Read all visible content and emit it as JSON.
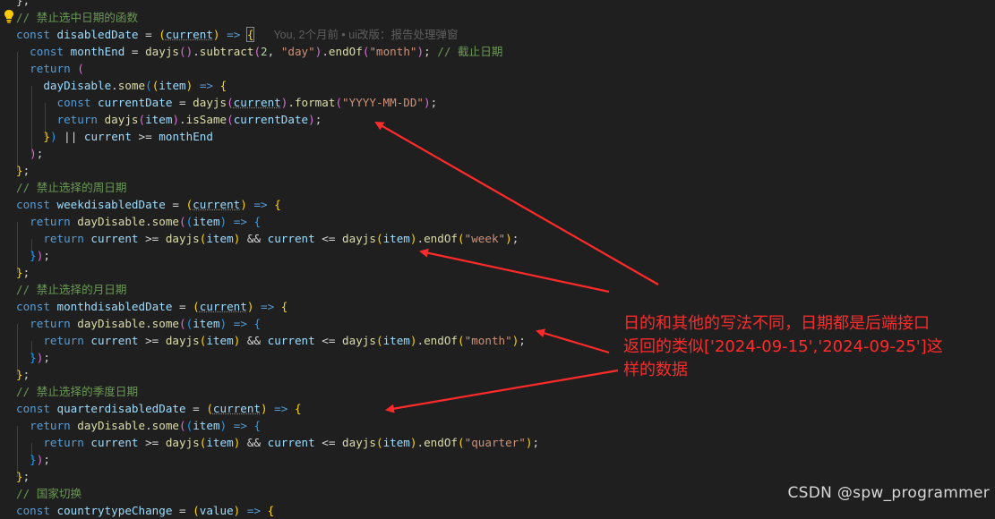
{
  "colors": {
    "background": "#1f1f1f",
    "keyword": "#569cd6",
    "variable": "#9cdcfe",
    "function": "#dcdcaa",
    "string": "#ce9178",
    "number": "#b5cea8",
    "comment": "#6a9955",
    "operator": "#d4d4d4",
    "bracket_gold": "#ffd700",
    "bracket_purple": "#da70d6",
    "bracket_blue": "#179fff",
    "annotation": "#ff2a2a",
    "bulb": "#ffcc00"
  },
  "icons": {
    "gutter": "lightbulb-icon"
  },
  "blame_annotation": "You, 2个月前 • ui改版：报告处理弹窗",
  "code_lines": [
    [
      {
        "t": "};",
        "c": "operator"
      }
    ],
    [
      {
        "t": "// 禁止选中日期的函数",
        "c": "comment"
      }
    ],
    [
      {
        "t": "const ",
        "c": "keyword"
      },
      {
        "t": "disabledDate",
        "c": "variable"
      },
      {
        "t": " = ",
        "c": "operator"
      },
      {
        "t": "(",
        "c": "bracket_gold"
      },
      {
        "t": "current",
        "c": "variable"
      },
      {
        "t": ")",
        "c": "bracket_gold"
      },
      {
        "t": " ",
        "c": "operator"
      },
      {
        "t": "=>",
        "c": "keyword"
      },
      {
        "t": " ",
        "c": "operator"
      },
      {
        "t": "{",
        "c": "bracket_gold"
      }
    ],
    [
      {
        "t": "  const ",
        "c": "keyword"
      },
      {
        "t": "monthEnd",
        "c": "variable"
      },
      {
        "t": " = ",
        "c": "operator"
      },
      {
        "t": "dayjs",
        "c": "function"
      },
      {
        "t": "()",
        "c": "bracket_purple"
      },
      {
        "t": ".",
        "c": "operator"
      },
      {
        "t": "subtract",
        "c": "function"
      },
      {
        "t": "(",
        "c": "bracket_purple"
      },
      {
        "t": "2",
        "c": "number"
      },
      {
        "t": ", ",
        "c": "operator"
      },
      {
        "t": "\"day\"",
        "c": "string"
      },
      {
        "t": ")",
        "c": "bracket_purple"
      },
      {
        "t": ".",
        "c": "operator"
      },
      {
        "t": "endOf",
        "c": "function"
      },
      {
        "t": "(",
        "c": "bracket_purple"
      },
      {
        "t": "\"month\"",
        "c": "string"
      },
      {
        "t": ")",
        "c": "bracket_purple"
      },
      {
        "t": "; ",
        "c": "operator"
      },
      {
        "t": "// 截止日期",
        "c": "comment"
      }
    ],
    [
      {
        "t": "  return ",
        "c": "keyword"
      },
      {
        "t": "(",
        "c": "bracket_purple"
      }
    ],
    [
      {
        "t": "    dayDisable",
        "c": "variable"
      },
      {
        "t": ".",
        "c": "operator"
      },
      {
        "t": "some",
        "c": "function"
      },
      {
        "t": "(",
        "c": "bracket_blue"
      },
      {
        "t": "(",
        "c": "bracket_gold"
      },
      {
        "t": "item",
        "c": "variable"
      },
      {
        "t": ")",
        "c": "bracket_gold"
      },
      {
        "t": " ",
        "c": "operator"
      },
      {
        "t": "=>",
        "c": "keyword"
      },
      {
        "t": " ",
        "c": "operator"
      },
      {
        "t": "{",
        "c": "bracket_gold"
      }
    ],
    [
      {
        "t": "      const ",
        "c": "keyword"
      },
      {
        "t": "currentDate",
        "c": "variable"
      },
      {
        "t": " = ",
        "c": "operator"
      },
      {
        "t": "dayjs",
        "c": "function"
      },
      {
        "t": "(",
        "c": "bracket_purple"
      },
      {
        "t": "current",
        "c": "variable"
      },
      {
        "t": ")",
        "c": "bracket_purple"
      },
      {
        "t": ".",
        "c": "operator"
      },
      {
        "t": "format",
        "c": "function"
      },
      {
        "t": "(",
        "c": "bracket_purple"
      },
      {
        "t": "\"YYYY-MM-DD\"",
        "c": "string"
      },
      {
        "t": ")",
        "c": "bracket_purple"
      },
      {
        "t": ";",
        "c": "operator"
      }
    ],
    [
      {
        "t": "      return ",
        "c": "keyword"
      },
      {
        "t": "dayjs",
        "c": "function"
      },
      {
        "t": "(",
        "c": "bracket_purple"
      },
      {
        "t": "item",
        "c": "variable"
      },
      {
        "t": ")",
        "c": "bracket_purple"
      },
      {
        "t": ".",
        "c": "operator"
      },
      {
        "t": "isSame",
        "c": "function"
      },
      {
        "t": "(",
        "c": "bracket_purple"
      },
      {
        "t": "currentDate",
        "c": "variable"
      },
      {
        "t": ")",
        "c": "bracket_purple"
      },
      {
        "t": ";",
        "c": "operator"
      }
    ],
    [
      {
        "t": "    ",
        "c": "operator"
      },
      {
        "t": "}",
        "c": "bracket_gold"
      },
      {
        "t": ")",
        "c": "bracket_blue"
      },
      {
        "t": " || ",
        "c": "operator"
      },
      {
        "t": "current",
        "c": "variable"
      },
      {
        "t": " >= ",
        "c": "operator"
      },
      {
        "t": "monthEnd",
        "c": "variable"
      }
    ],
    [
      {
        "t": "  ",
        "c": "operator"
      },
      {
        "t": ")",
        "c": "bracket_purple"
      },
      {
        "t": ";",
        "c": "operator"
      }
    ],
    [
      {
        "t": "}",
        "c": "bracket_gold"
      },
      {
        "t": ";",
        "c": "operator"
      }
    ],
    [
      {
        "t": "// 禁止选择的周日期",
        "c": "comment"
      }
    ],
    [
      {
        "t": "const ",
        "c": "keyword"
      },
      {
        "t": "weekdisabledDate",
        "c": "variable"
      },
      {
        "t": " = ",
        "c": "operator"
      },
      {
        "t": "(",
        "c": "bracket_gold"
      },
      {
        "t": "current",
        "c": "variable"
      },
      {
        "t": ")",
        "c": "bracket_gold"
      },
      {
        "t": " ",
        "c": "operator"
      },
      {
        "t": "=>",
        "c": "keyword"
      },
      {
        "t": " ",
        "c": "operator"
      },
      {
        "t": "{",
        "c": "bracket_gold"
      }
    ],
    [
      {
        "t": "  return ",
        "c": "keyword"
      },
      {
        "t": "dayDisable",
        "c": "function"
      },
      {
        "t": ".",
        "c": "operator"
      },
      {
        "t": "some",
        "c": "function"
      },
      {
        "t": "(",
        "c": "bracket_purple"
      },
      {
        "t": "(",
        "c": "bracket_blue"
      },
      {
        "t": "item",
        "c": "variable"
      },
      {
        "t": ")",
        "c": "bracket_blue"
      },
      {
        "t": " ",
        "c": "operator"
      },
      {
        "t": "=>",
        "c": "keyword"
      },
      {
        "t": " ",
        "c": "operator"
      },
      {
        "t": "{",
        "c": "bracket_blue"
      }
    ],
    [
      {
        "t": "    return ",
        "c": "keyword"
      },
      {
        "t": "current",
        "c": "variable"
      },
      {
        "t": " >= ",
        "c": "operator"
      },
      {
        "t": "dayjs",
        "c": "function"
      },
      {
        "t": "(",
        "c": "bracket_gold"
      },
      {
        "t": "item",
        "c": "variable"
      },
      {
        "t": ")",
        "c": "bracket_gold"
      },
      {
        "t": " && ",
        "c": "operator"
      },
      {
        "t": "current",
        "c": "variable"
      },
      {
        "t": " <= ",
        "c": "operator"
      },
      {
        "t": "dayjs",
        "c": "function"
      },
      {
        "t": "(",
        "c": "bracket_gold"
      },
      {
        "t": "item",
        "c": "variable"
      },
      {
        "t": ")",
        "c": "bracket_gold"
      },
      {
        "t": ".",
        "c": "operator"
      },
      {
        "t": "endOf",
        "c": "function"
      },
      {
        "t": "(",
        "c": "bracket_gold"
      },
      {
        "t": "\"week\"",
        "c": "string"
      },
      {
        "t": ")",
        "c": "bracket_gold"
      },
      {
        "t": ";",
        "c": "operator"
      }
    ],
    [
      {
        "t": "  ",
        "c": "operator"
      },
      {
        "t": "}",
        "c": "bracket_blue"
      },
      {
        "t": ")",
        "c": "bracket_purple"
      },
      {
        "t": ";",
        "c": "operator"
      }
    ],
    [
      {
        "t": "}",
        "c": "bracket_gold"
      },
      {
        "t": ";",
        "c": "operator"
      }
    ],
    [
      {
        "t": "// 禁止选择的月日期",
        "c": "comment"
      }
    ],
    [
      {
        "t": "const ",
        "c": "keyword"
      },
      {
        "t": "monthdisabledDate",
        "c": "variable"
      },
      {
        "t": " = ",
        "c": "operator"
      },
      {
        "t": "(",
        "c": "bracket_gold"
      },
      {
        "t": "current",
        "c": "variable"
      },
      {
        "t": ")",
        "c": "bracket_gold"
      },
      {
        "t": " ",
        "c": "operator"
      },
      {
        "t": "=>",
        "c": "keyword"
      },
      {
        "t": " ",
        "c": "operator"
      },
      {
        "t": "{",
        "c": "bracket_gold"
      }
    ],
    [
      {
        "t": "  return ",
        "c": "keyword"
      },
      {
        "t": "dayDisable",
        "c": "function"
      },
      {
        "t": ".",
        "c": "operator"
      },
      {
        "t": "some",
        "c": "function"
      },
      {
        "t": "(",
        "c": "bracket_purple"
      },
      {
        "t": "(",
        "c": "bracket_blue"
      },
      {
        "t": "item",
        "c": "variable"
      },
      {
        "t": ")",
        "c": "bracket_blue"
      },
      {
        "t": " ",
        "c": "operator"
      },
      {
        "t": "=>",
        "c": "keyword"
      },
      {
        "t": " ",
        "c": "operator"
      },
      {
        "t": "{",
        "c": "bracket_blue"
      }
    ],
    [
      {
        "t": "    return ",
        "c": "keyword"
      },
      {
        "t": "current",
        "c": "variable"
      },
      {
        "t": " >= ",
        "c": "operator"
      },
      {
        "t": "dayjs",
        "c": "function"
      },
      {
        "t": "(",
        "c": "bracket_gold"
      },
      {
        "t": "item",
        "c": "variable"
      },
      {
        "t": ")",
        "c": "bracket_gold"
      },
      {
        "t": " && ",
        "c": "operator"
      },
      {
        "t": "current",
        "c": "variable"
      },
      {
        "t": " <= ",
        "c": "operator"
      },
      {
        "t": "dayjs",
        "c": "function"
      },
      {
        "t": "(",
        "c": "bracket_gold"
      },
      {
        "t": "item",
        "c": "variable"
      },
      {
        "t": ")",
        "c": "bracket_gold"
      },
      {
        "t": ".",
        "c": "operator"
      },
      {
        "t": "endOf",
        "c": "function"
      },
      {
        "t": "(",
        "c": "bracket_gold"
      },
      {
        "t": "\"month\"",
        "c": "string"
      },
      {
        "t": ")",
        "c": "bracket_gold"
      },
      {
        "t": ";",
        "c": "operator"
      }
    ],
    [
      {
        "t": "  ",
        "c": "operator"
      },
      {
        "t": "}",
        "c": "bracket_blue"
      },
      {
        "t": ")",
        "c": "bracket_purple"
      },
      {
        "t": ";",
        "c": "operator"
      }
    ],
    [
      {
        "t": "}",
        "c": "bracket_gold"
      },
      {
        "t": ";",
        "c": "operator"
      }
    ],
    [
      {
        "t": "// 禁止选择的季度日期",
        "c": "comment"
      }
    ],
    [
      {
        "t": "const ",
        "c": "keyword"
      },
      {
        "t": "quarterdisabledDate",
        "c": "variable"
      },
      {
        "t": " = ",
        "c": "operator"
      },
      {
        "t": "(",
        "c": "bracket_gold"
      },
      {
        "t": "current",
        "c": "variable"
      },
      {
        "t": ")",
        "c": "bracket_gold"
      },
      {
        "t": " ",
        "c": "operator"
      },
      {
        "t": "=>",
        "c": "keyword"
      },
      {
        "t": " ",
        "c": "operator"
      },
      {
        "t": "{",
        "c": "bracket_gold"
      }
    ],
    [
      {
        "t": "  return ",
        "c": "keyword"
      },
      {
        "t": "dayDisable",
        "c": "function"
      },
      {
        "t": ".",
        "c": "operator"
      },
      {
        "t": "some",
        "c": "function"
      },
      {
        "t": "(",
        "c": "bracket_purple"
      },
      {
        "t": "(",
        "c": "bracket_blue"
      },
      {
        "t": "item",
        "c": "variable"
      },
      {
        "t": ")",
        "c": "bracket_blue"
      },
      {
        "t": " ",
        "c": "operator"
      },
      {
        "t": "=>",
        "c": "keyword"
      },
      {
        "t": " ",
        "c": "operator"
      },
      {
        "t": "{",
        "c": "bracket_blue"
      }
    ],
    [
      {
        "t": "    return ",
        "c": "keyword"
      },
      {
        "t": "current",
        "c": "variable"
      },
      {
        "t": " >= ",
        "c": "operator"
      },
      {
        "t": "dayjs",
        "c": "function"
      },
      {
        "t": "(",
        "c": "bracket_gold"
      },
      {
        "t": "item",
        "c": "variable"
      },
      {
        "t": ")",
        "c": "bracket_gold"
      },
      {
        "t": " && ",
        "c": "operator"
      },
      {
        "t": "current",
        "c": "variable"
      },
      {
        "t": " <= ",
        "c": "operator"
      },
      {
        "t": "dayjs",
        "c": "function"
      },
      {
        "t": "(",
        "c": "bracket_gold"
      },
      {
        "t": "item",
        "c": "variable"
      },
      {
        "t": ")",
        "c": "bracket_gold"
      },
      {
        "t": ".",
        "c": "operator"
      },
      {
        "t": "endOf",
        "c": "function"
      },
      {
        "t": "(",
        "c": "bracket_gold"
      },
      {
        "t": "\"quarter\"",
        "c": "string"
      },
      {
        "t": ")",
        "c": "bracket_gold"
      },
      {
        "t": ";",
        "c": "operator"
      }
    ],
    [
      {
        "t": "  ",
        "c": "operator"
      },
      {
        "t": "}",
        "c": "bracket_blue"
      },
      {
        "t": ")",
        "c": "bracket_purple"
      },
      {
        "t": ";",
        "c": "operator"
      }
    ],
    [
      {
        "t": "}",
        "c": "bracket_gold"
      },
      {
        "t": ";",
        "c": "operator"
      }
    ],
    [
      {
        "t": "// 国家切换",
        "c": "comment"
      }
    ],
    [
      {
        "t": "const ",
        "c": "keyword"
      },
      {
        "t": "countrytypeChange",
        "c": "variable"
      },
      {
        "t": " = ",
        "c": "operator"
      },
      {
        "t": "(",
        "c": "bracket_gold"
      },
      {
        "t": "value",
        "c": "variable"
      },
      {
        "t": ")",
        "c": "bracket_gold"
      },
      {
        "t": " ",
        "c": "operator"
      },
      {
        "t": "=>",
        "c": "keyword"
      },
      {
        "t": " ",
        "c": "operator"
      },
      {
        "t": "{",
        "c": "bracket_gold"
      }
    ]
  ],
  "annotation": {
    "lines": [
      "日的和其他的写法不同，日期都是后端接口",
      "返回的类似['2024-09-15','2024-09-25']这",
      "样的数据"
    ]
  },
  "watermark": "CSDN @spw_programmer"
}
